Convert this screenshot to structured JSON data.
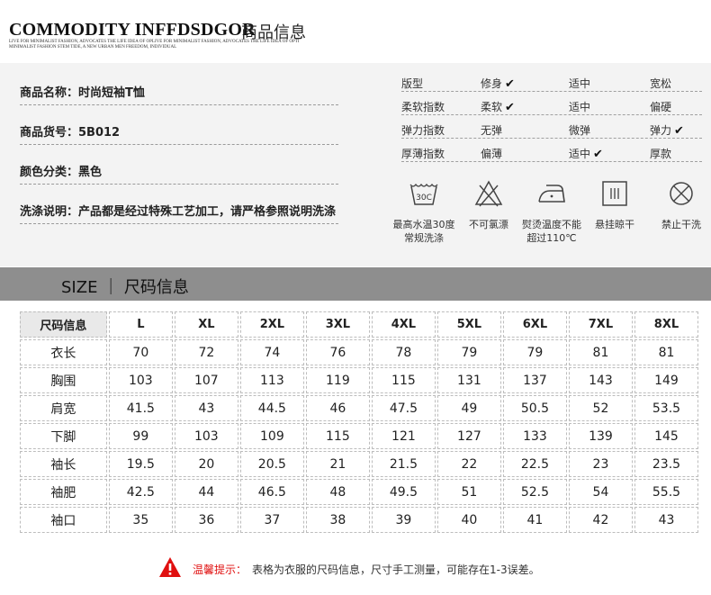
{
  "header": {
    "title_en": "COMMODITY INFFDSDGOR",
    "title_cn": "商品信息",
    "tagline": "LIVE FOR MINIMALIST FASHION, ADVOCATES THE LIFE IDEA OF OPLIVE FOR MINIMALIST FASHION, ADVOCATES THE LIFE IDEA OF OPTI MINIMALIST FASHION STEM TIDE, A NEW URBAN MEN FREEDOM, INDIVIDUAL"
  },
  "product": {
    "name": "商品名称：时尚短袖T恤",
    "code": "商品货号：5B012",
    "color": "颜色分类：黑色",
    "wash": "洗涤说明：产品都是经过特殊工艺加工，请严格参照说明洗涤"
  },
  "attributes": [
    {
      "label": "版型",
      "options": [
        "修身",
        "适中",
        "宽松"
      ],
      "checked": 0
    },
    {
      "label": "柔软指数",
      "options": [
        "柔软",
        "适中",
        "偏硬"
      ],
      "checked": 0
    },
    {
      "label": "弹力指数",
      "options": [
        "无弹",
        "微弹",
        "弹力"
      ],
      "checked": 2
    },
    {
      "label": "厚薄指数",
      "options": [
        "偏薄",
        "适中",
        "厚款"
      ],
      "checked": 1
    }
  ],
  "care": [
    {
      "icon": "wash-30-icon",
      "line1": "最高水温30度",
      "line2": "常规洗涤",
      "symbol": "30C"
    },
    {
      "icon": "no-bleach-icon",
      "line1": "不可氯漂",
      "line2": ""
    },
    {
      "icon": "iron-icon",
      "line1": "熨烫温度不能",
      "line2": "超过110℃"
    },
    {
      "icon": "hang-dry-icon",
      "line1": "悬挂晾干",
      "line2": ""
    },
    {
      "icon": "no-tumble-dry-icon",
      "line1": "禁止干洗",
      "line2": ""
    }
  ],
  "size_banner": "SIZE ｜ 尺码信息",
  "size_table": {
    "headers": [
      "尺码信息",
      "L",
      "XL",
      "2XL",
      "3XL",
      "4XL",
      "5XL",
      "6XL",
      "7XL",
      "8XL"
    ],
    "rows": [
      [
        "衣长",
        "70",
        "72",
        "74",
        "76",
        "78",
        "79",
        "79",
        "81",
        "81"
      ],
      [
        "胸围",
        "103",
        "107",
        "113",
        "119",
        "115",
        "131",
        "137",
        "143",
        "149"
      ],
      [
        "肩宽",
        "41.5",
        "43",
        "44.5",
        "46",
        "47.5",
        "49",
        "50.5",
        "52",
        "53.5"
      ],
      [
        "下脚",
        "99",
        "103",
        "109",
        "115",
        "121",
        "127",
        "133",
        "139",
        "145"
      ],
      [
        "袖长",
        "19.5",
        "20",
        "20.5",
        "21",
        "21.5",
        "22",
        "22.5",
        "23",
        "23.5"
      ],
      [
        "袖肥",
        "42.5",
        "44",
        "46.5",
        "48",
        "49.5",
        "51",
        "52.5",
        "54",
        "55.5"
      ],
      [
        "袖口",
        "35",
        "36",
        "37",
        "38",
        "39",
        "40",
        "41",
        "42",
        "43"
      ]
    ]
  },
  "tip": {
    "label": "温馨提示：",
    "text": "表格为衣服的尺码信息，尺寸手工测量，可能存在1-3误差。"
  },
  "colors": {
    "banner_bg": "#8e8e8e",
    "panel_bg": "#f3f3f3",
    "warning": "#e01010"
  }
}
